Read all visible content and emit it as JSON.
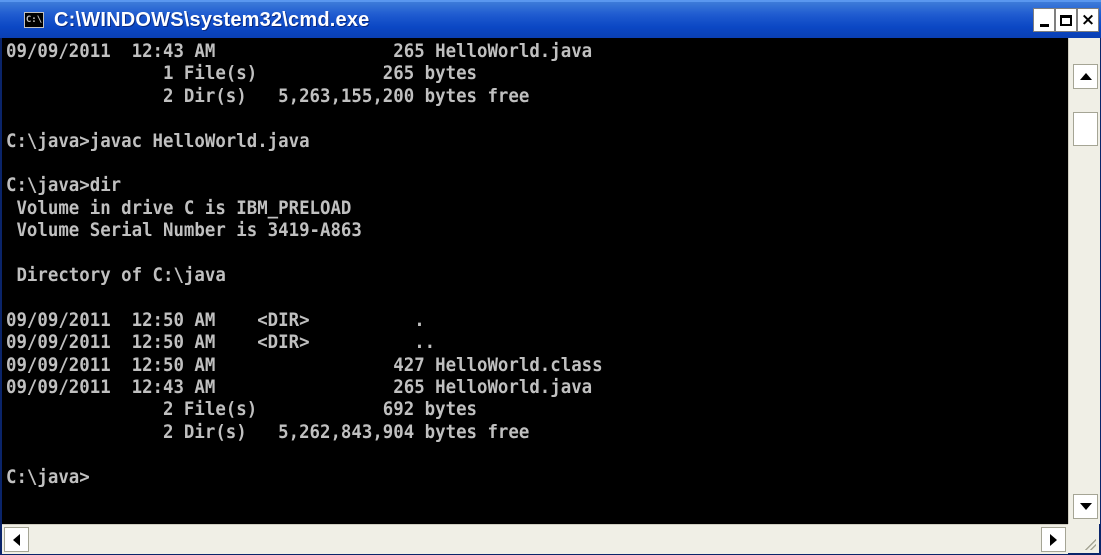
{
  "window": {
    "title": "C:\\WINDOWS\\system32\\cmd.exe",
    "icon": "console-app-icon",
    "icon_text": "C:\\"
  },
  "controls": {
    "minimize_icon": "minimize-icon",
    "maximize_icon": "maximize-icon",
    "close_icon": "close-icon",
    "close_glyph": "×"
  },
  "console": {
    "lines": [
      "09/09/2011  12:43 AM                 265 HelloWorld.java",
      "               1 File(s)            265 bytes",
      "               2 Dir(s)   5,263,155,200 bytes free",
      "",
      "C:\\java>javac HelloWorld.java",
      "",
      "C:\\java>dir",
      " Volume in drive C is IBM_PRELOAD",
      " Volume Serial Number is 3419-A863",
      "",
      " Directory of C:\\java",
      "",
      "09/09/2011  12:50 AM    <DIR>          .",
      "09/09/2011  12:50 AM    <DIR>          ..",
      "09/09/2011  12:50 AM                 427 HelloWorld.class",
      "09/09/2011  12:43 AM                 265 HelloWorld.java",
      "               2 File(s)            692 bytes",
      "               2 Dir(s)   5,262,843,904 bytes free",
      "",
      "C:\\java>"
    ]
  },
  "colors": {
    "console_bg": "#000000",
    "console_fg": "#c0c0c0",
    "titlebar": "#0a47c4"
  }
}
